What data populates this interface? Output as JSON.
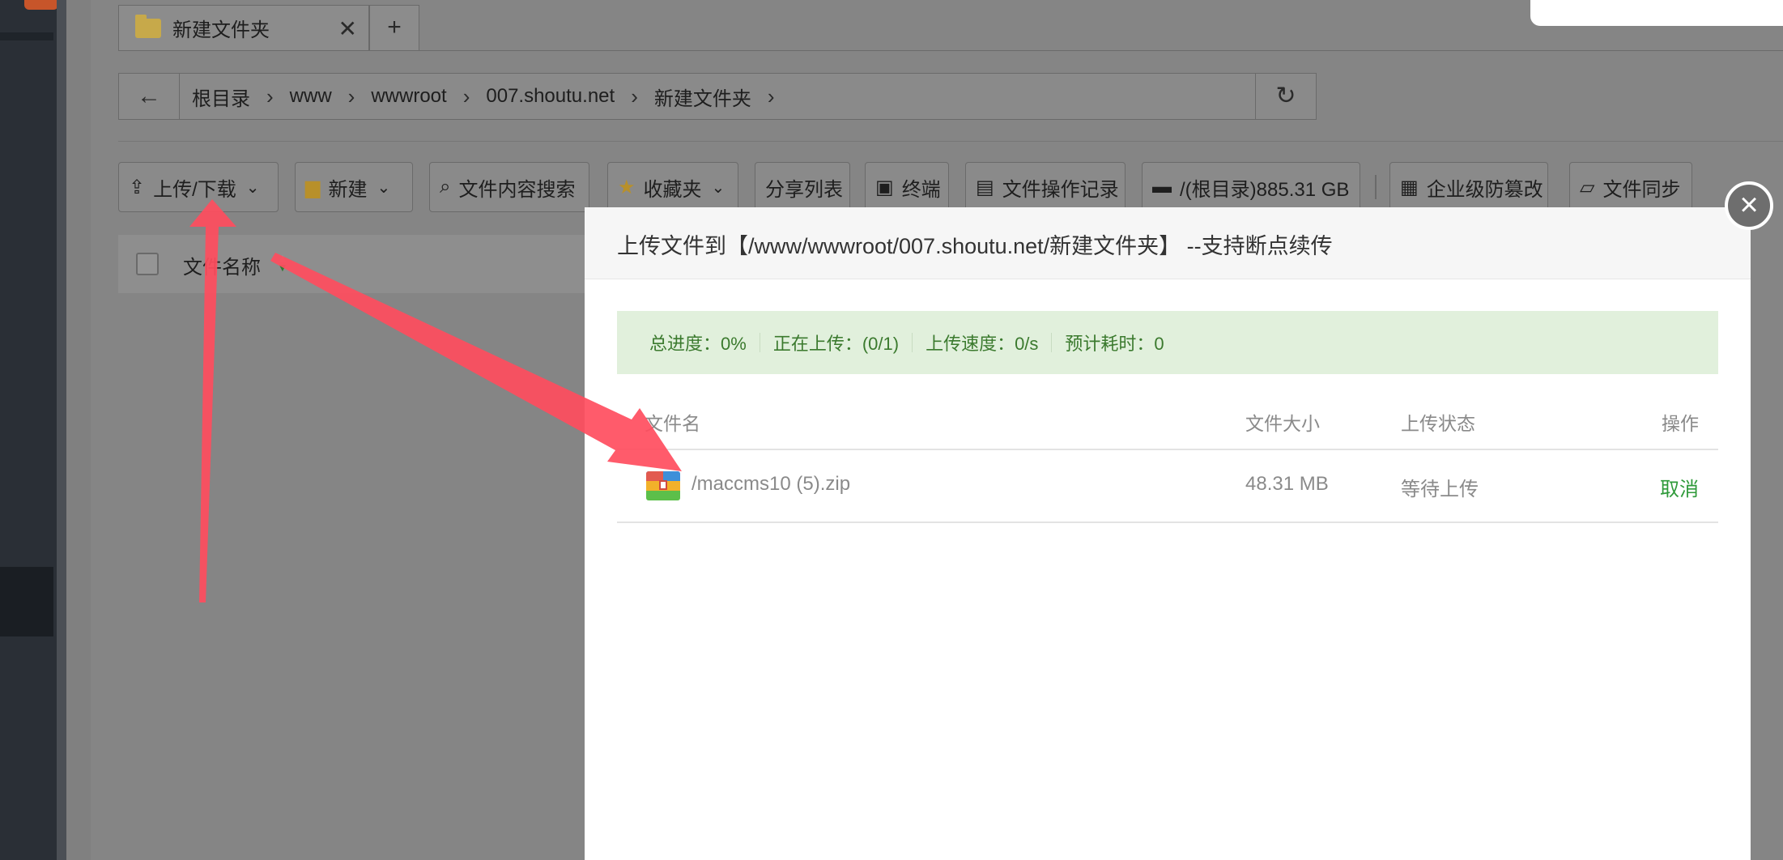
{
  "tab": {
    "title": "新建文件夹",
    "close_icon": "close-icon",
    "add_label": "+"
  },
  "breadcrumb": {
    "back_icon": "arrow-left-icon",
    "items": [
      "根目录",
      "www",
      "wwwroot",
      "007.shoutu.net",
      "新建文件夹"
    ],
    "separator": ">",
    "refresh_icon": "refresh-icon"
  },
  "toolbar": {
    "upload_label": "上传/下载",
    "new_label": "新建",
    "search_label": "文件内容搜索",
    "favorites_label": "收藏夹",
    "share_label": "分享列表",
    "terminal_label": "终端",
    "oplog_label": "文件操作记录",
    "disk_label": "/(根目录)885.31 GB",
    "tamper_label": "企业级防篡改",
    "sync_label": "文件同步"
  },
  "file_table": {
    "name_header": "文件名称"
  },
  "modal": {
    "title": "上传文件到【/www/wwwroot/007.shoutu.net/新建文件夹】 --支持断点续传",
    "progress": {
      "total": "总进度：0%",
      "uploading": "正在上传：(0/1)",
      "speed": "上传速度：0/s",
      "eta": "预计耗时：0"
    },
    "columns": {
      "name": "文件名",
      "size": "文件大小",
      "status": "上传状态",
      "action": "操作"
    },
    "files": [
      {
        "name": "/maccms10 (5).zip",
        "size": "48.31 MB",
        "status": "等待上传",
        "action": "取消"
      }
    ]
  },
  "colors": {
    "accent_green": "#2f9a3a",
    "progress_bg": "#e1f0dc",
    "arrow": "#ff4d5e"
  }
}
